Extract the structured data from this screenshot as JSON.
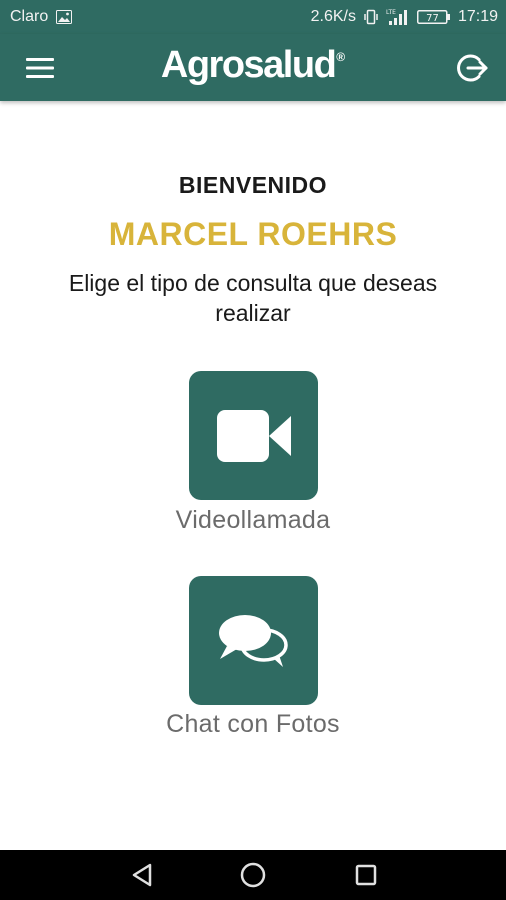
{
  "status_bar": {
    "carrier": "Claro",
    "speed": "2.6K/s",
    "network_label": "LTE",
    "battery": "77",
    "time": "17:19"
  },
  "app_bar": {
    "brand": "Agrosalud",
    "brand_mark": "®"
  },
  "welcome": {
    "title": "BIENVENIDO",
    "user_name": "MARCEL ROEHRS",
    "prompt": "Elige el tipo de consulta que deseas realizar"
  },
  "options": [
    {
      "label": "Videollamada",
      "icon": "video-camera-icon"
    },
    {
      "label": "Chat con Fotos",
      "icon": "chat-bubbles-icon"
    }
  ],
  "colors": {
    "primary": "#2f6b62",
    "accent_gold": "#d8b43a",
    "label_gray": "#6b6b6b"
  }
}
